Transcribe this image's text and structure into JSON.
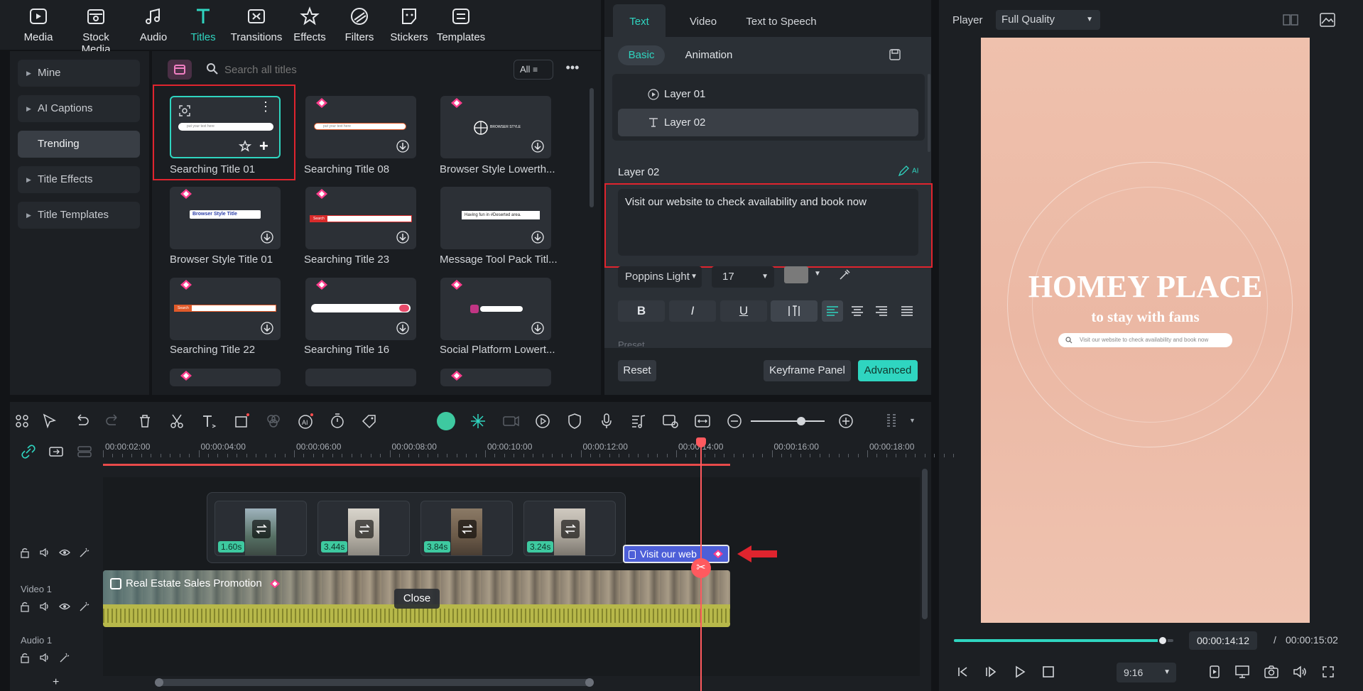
{
  "toolbar": {
    "items": [
      {
        "label": "Media",
        "icon": "media-icon"
      },
      {
        "label": "Stock Media",
        "icon": "stock-media-icon"
      },
      {
        "label": "Audio",
        "icon": "audio-icon"
      },
      {
        "label": "Titles",
        "icon": "titles-icon"
      },
      {
        "label": "Transitions",
        "icon": "transitions-icon"
      },
      {
        "label": "Effects",
        "icon": "effects-icon"
      },
      {
        "label": "Filters",
        "icon": "filters-icon"
      },
      {
        "label": "Stickers",
        "icon": "stickers-icon"
      },
      {
        "label": "Templates",
        "icon": "templates-icon"
      }
    ],
    "active": "Titles"
  },
  "categories": {
    "items": [
      "Mine",
      "AI Captions",
      "Trending",
      "Title Effects",
      "Title Templates"
    ],
    "active": "Trending"
  },
  "library": {
    "search_placeholder": "Search all titles",
    "filter_label": "All",
    "titles": [
      "Searching Title 01",
      "Searching Title 08",
      "Browser Style Lowerth...",
      "Browser Style Title 01",
      "Searching Title 23",
      "Message Tool Pack Titl...",
      "Searching Title 22",
      "Searching Title 16",
      "Social Platform Lowert..."
    ],
    "thumb_texts": {
      "search_placeholder": "put your text here",
      "browser_title": "Browser Style Title",
      "search_label": "Search",
      "message": "Having fun in #Deserted area.",
      "browser_brand": "BROWSER STYLE"
    }
  },
  "text_panel": {
    "tabs": [
      "Text",
      "Video",
      "Text to Speech"
    ],
    "active_tab": "Text",
    "subtabs": [
      "Basic",
      "Animation"
    ],
    "active_subtab": "Basic",
    "layers": [
      "Layer 01",
      "Layer 02"
    ],
    "selected_layer": "Layer 02",
    "layer_heading": "Layer 02",
    "ai_badge": "AI",
    "text_value": "Visit our website to check availability and book now",
    "font": "Poppins Light",
    "size": "17",
    "color": "#7a7a7a",
    "format_buttons": [
      "B",
      "I",
      "U"
    ],
    "preset_label": "Preset",
    "reset_label": "Reset",
    "keyframe_label": "Keyframe Panel",
    "advanced_label": "Advanced"
  },
  "player": {
    "label": "Player",
    "quality": "Full Quality",
    "title_line1": "HOMEY PLACE",
    "title_line2": "to stay with fams",
    "search_text": "Visit our website to check availability and book now",
    "current_time": "00:00:14:12",
    "total_time": "00:00:15:02",
    "separator": "/",
    "aspect": "9:16",
    "progress": 0.95
  },
  "timeline": {
    "ruler": [
      "00:00:02:00",
      "00:00:04:00",
      "00:00:06:00",
      "00:00:08:00",
      "00:00:10:00",
      "00:00:12:00",
      "00:00:14:00",
      "00:00:16:00",
      "00:00:18:00"
    ],
    "clips": [
      "1.60s",
      "3.44s",
      "3.84s",
      "3.24s"
    ],
    "title_clip": "Visit our web",
    "video_track_label": "Video 1",
    "video_clip": "Real Estate Sales Promotion",
    "audio_track_label": "Audio 1",
    "close_label": "Close",
    "add_label": "+"
  },
  "colors": {
    "accent": "#2fd5c0",
    "highlight_box": "#e0242e",
    "playhead": "#ff5a5f",
    "title_clip": "#4d5fd8",
    "waveform": "#b7b84a"
  }
}
